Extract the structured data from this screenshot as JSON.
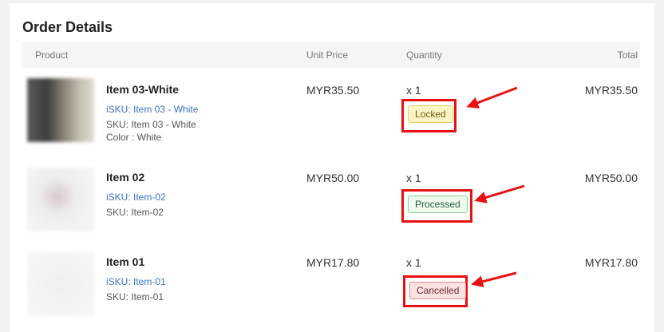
{
  "section_title": "Order Details",
  "columns": {
    "product": "Product",
    "unit_price": "Unit Price",
    "quantity": "Quantity",
    "total": "Total"
  },
  "items": [
    {
      "name": "Item 03-White",
      "isku": "iSKU: Item 03 - White",
      "sku": "SKU: Item 03 - White",
      "color": "Color : White",
      "unit_price": "MYR35.50",
      "quantity": "x 1",
      "status": "Locked",
      "total": "MYR35.50"
    },
    {
      "name": "Item 02",
      "isku": "iSKU: Item-02",
      "sku": "SKU: Item-02",
      "unit_price": "MYR50.00",
      "quantity": "x 1",
      "status": "Processed",
      "total": "MYR50.00"
    },
    {
      "name": "Item 01",
      "isku": "iSKU: Item-01",
      "sku": "SKU: Item-01",
      "unit_price": "MYR17.80",
      "quantity": "x 1",
      "status": "Cancelled",
      "total": "MYR17.80"
    }
  ],
  "colors": {
    "highlight": "#e81010",
    "link": "#3a73c8"
  }
}
